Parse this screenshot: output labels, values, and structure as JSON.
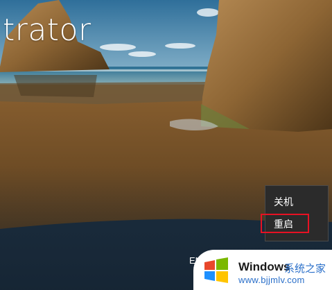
{
  "login": {
    "username_partial": "trator"
  },
  "power_menu": {
    "items": [
      {
        "label": "关机"
      },
      {
        "label": "重启"
      }
    ],
    "highlighted_item": "重启",
    "highlight_color": "#e81123"
  },
  "status_bar": {
    "language_partial": "EN"
  },
  "watermark": {
    "brand": "Windows",
    "site_name": "系统之家",
    "url": "www.bjjmlv.com"
  }
}
